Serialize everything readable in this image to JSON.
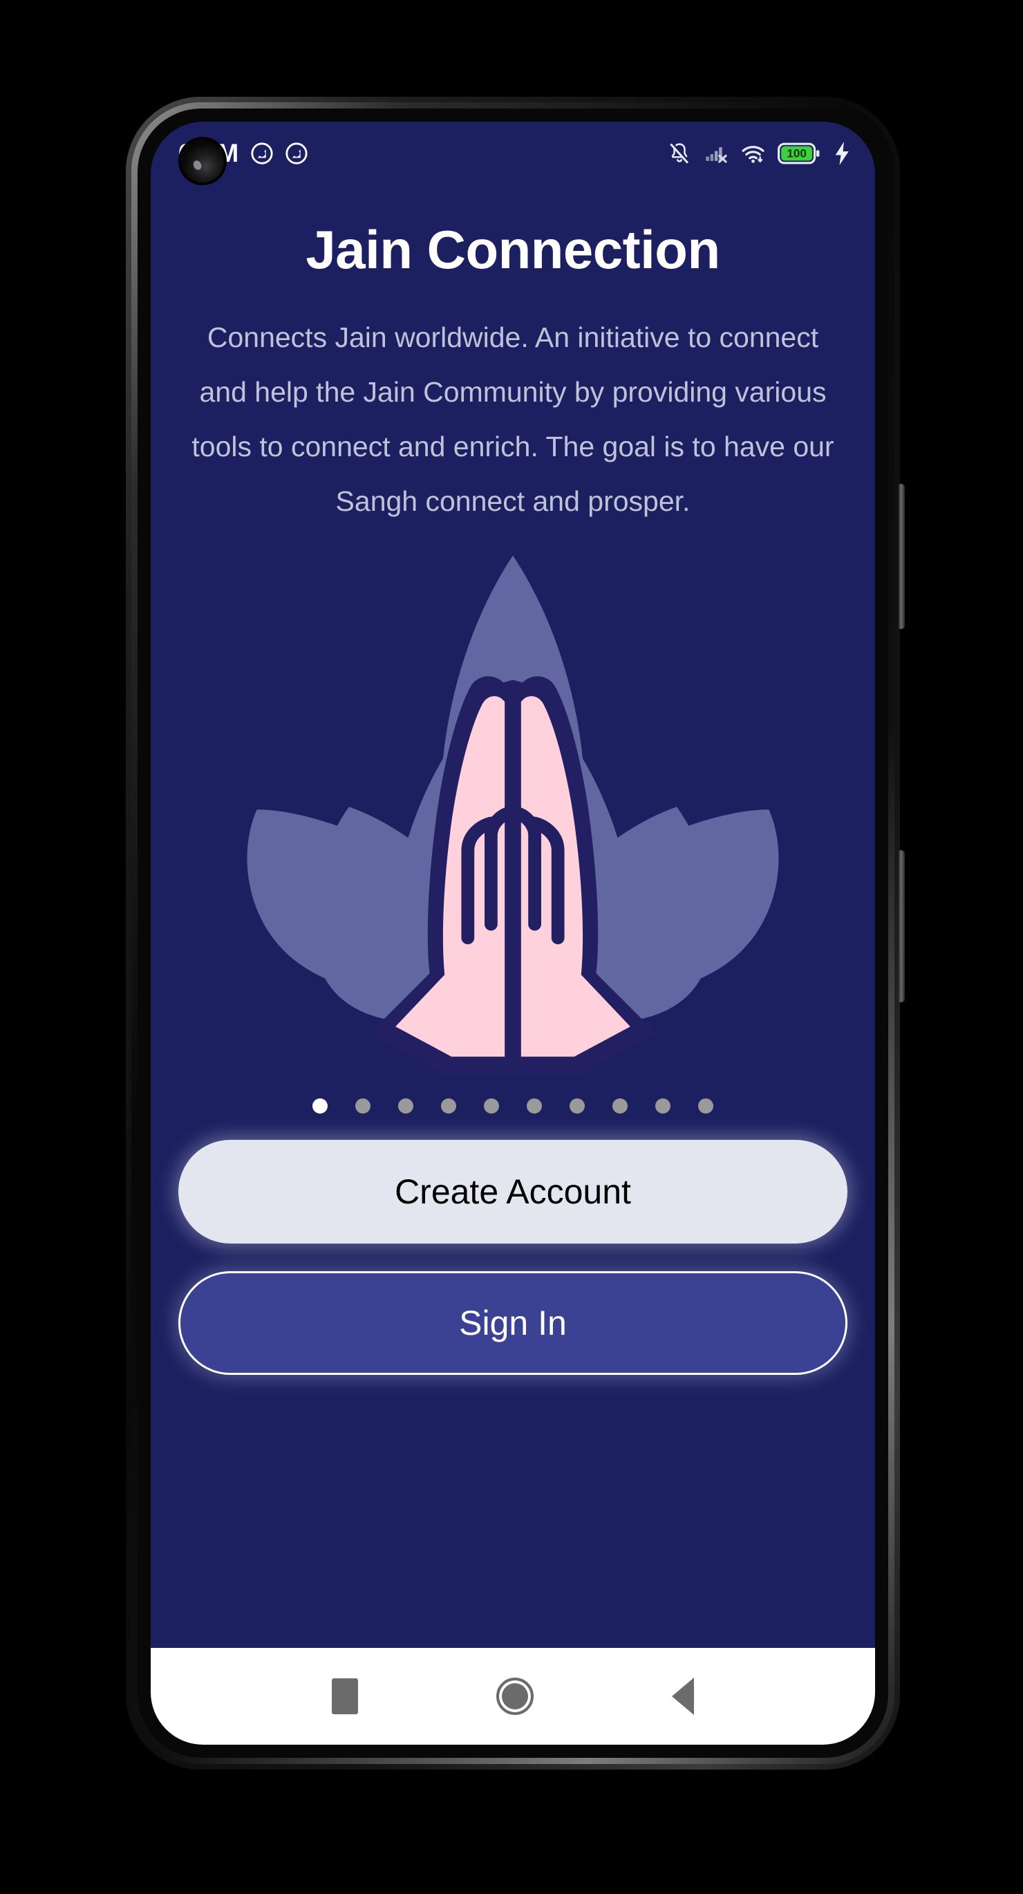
{
  "status_bar": {
    "time": "6 PM",
    "notification_icons": [
      "quiet-mode-icon",
      "quiet-mode-icon"
    ],
    "right_icons": [
      "bell-slash-icon",
      "signal-no-sim-icon",
      "wifi-icon",
      "battery-icon",
      "charging-bolt-icon"
    ],
    "battery_level": "100",
    "battery_color": "#3DD13D",
    "charging": true
  },
  "app": {
    "title": "Jain Connection",
    "description": "Connects Jain worldwide. An initiative to connect and help the Jain Community by providing various tools to connect and enrich. The goal is to have our Sangh connect and prosper.",
    "background_color": "#1C2060"
  },
  "illustration": {
    "name": "lotus-praying-hands-illustration",
    "petal_color": "#565C8F",
    "hand_fill_color": "#FFD1DC",
    "hand_outline_color": "#231F63"
  },
  "page_indicator": {
    "total": 10,
    "active_index": 0,
    "active_color": "#FFFFFF",
    "inactive_color": "#9A9A9A"
  },
  "buttons": {
    "create_account_label": "Create Account",
    "create_account_bg": "#E4E6EF",
    "sign_in_label": "Sign In",
    "sign_in_bg": "#3B4193"
  },
  "nav_bar": {
    "recents": "recents-icon",
    "home": "home-icon",
    "back": "back-icon"
  }
}
